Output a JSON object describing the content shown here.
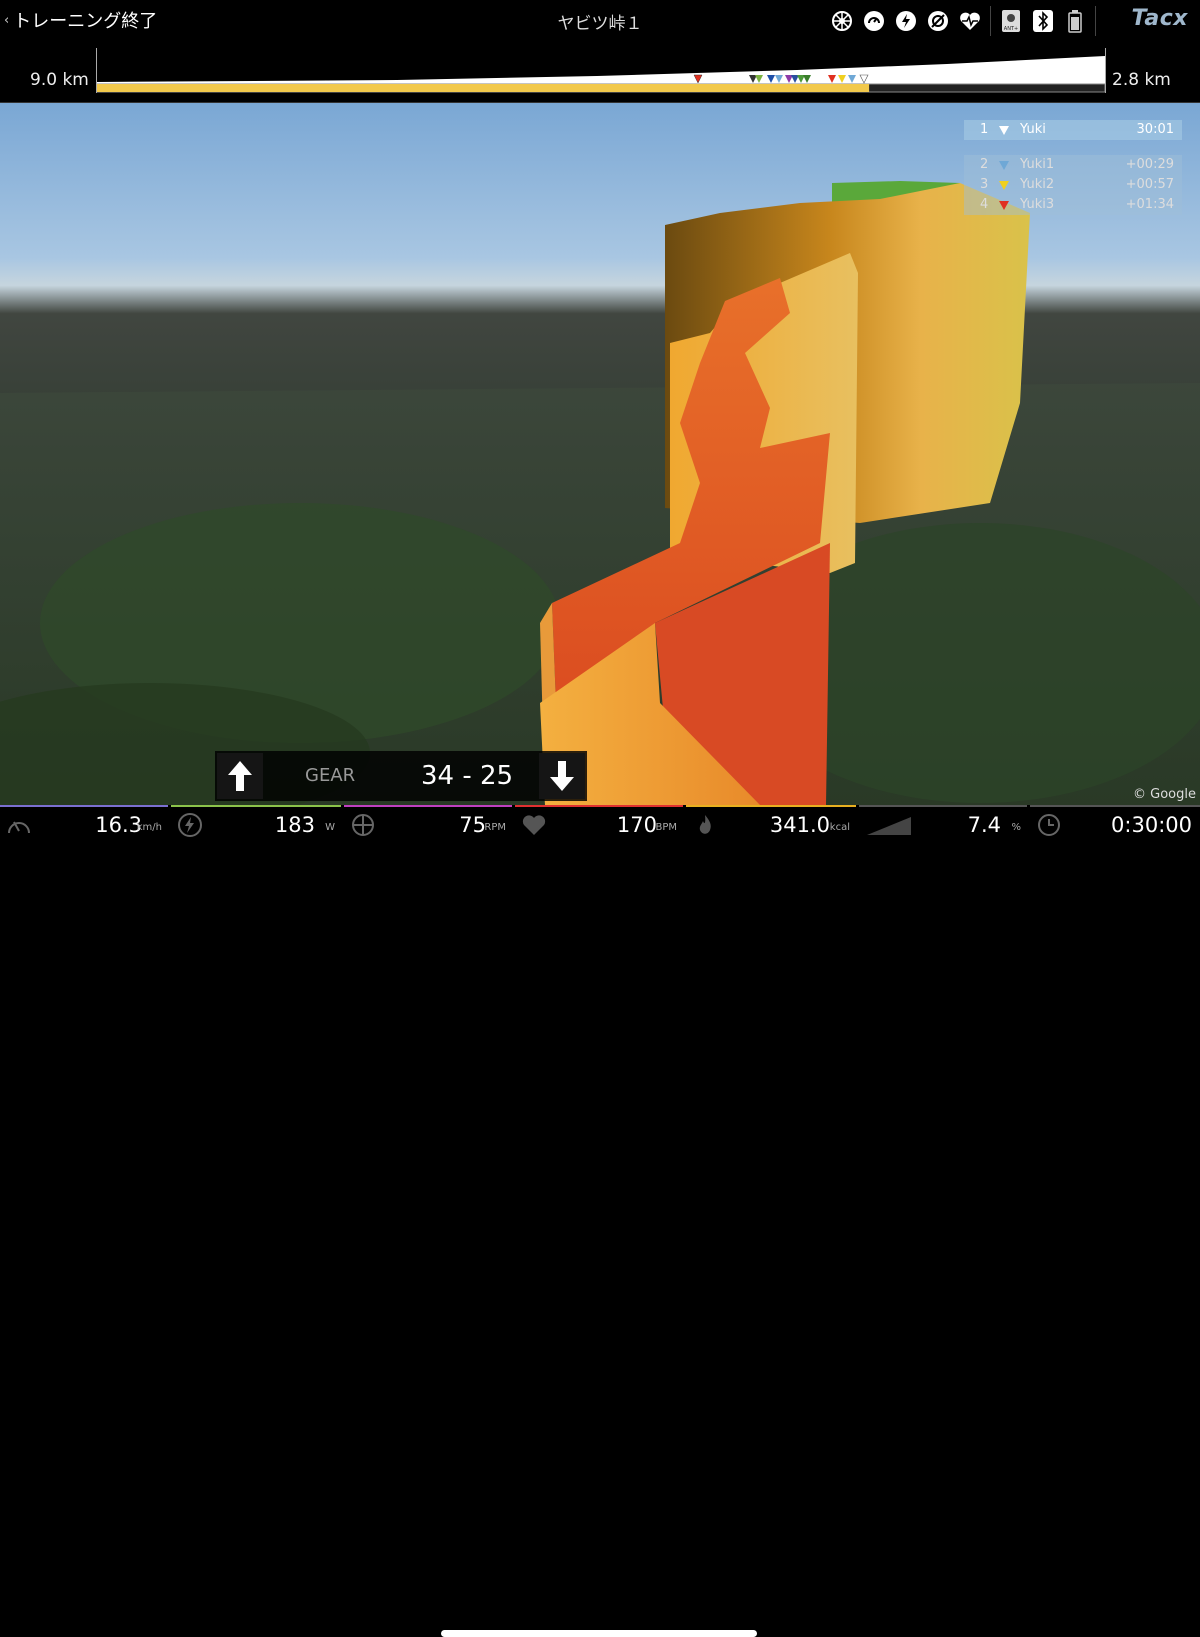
{
  "header": {
    "back_label": "トレーニング終了",
    "title": "ヤビツ峠１",
    "brand": "Tacx",
    "status_icons": [
      "wheel-icon",
      "speed-mode-icon",
      "power-icon",
      "target-icon",
      "heart-rate-icon",
      "ant-icon",
      "bluetooth-icon",
      "battery-icon"
    ]
  },
  "profile": {
    "distance_total": "9.0 km",
    "distance_remaining": "2.8 km",
    "progress": 0.766
  },
  "leaderboard": {
    "leader": {
      "rank": "1",
      "name": "Yuki",
      "time": "30:01",
      "color": "#ffffff"
    },
    "others": [
      {
        "rank": "2",
        "name": "Yuki1",
        "time": "+00:29",
        "color": "#6fa8d6"
      },
      {
        "rank": "3",
        "name": "Yuki2",
        "time": "+00:57",
        "color": "#f0d020"
      },
      {
        "rank": "4",
        "name": "Yuki3",
        "time": "+01:34",
        "color": "#e03020"
      }
    ]
  },
  "gear": {
    "label": "GEAR",
    "value": "34 - 25"
  },
  "copyright": "© Google",
  "metrics": [
    {
      "id": "speed",
      "value": "16.3",
      "unit": "km/h",
      "color": "#7a6fd0"
    },
    {
      "id": "power",
      "value": "183",
      "unit": "W",
      "color": "#8bc34a"
    },
    {
      "id": "cadence",
      "value": "75",
      "unit": "RPM",
      "color": "#c040c0"
    },
    {
      "id": "heart-rate",
      "value": "170",
      "unit": "BPM",
      "color": "#e03030"
    },
    {
      "id": "calories",
      "value": "341.0",
      "unit": "kcal",
      "color": "#e8b020"
    },
    {
      "id": "slope",
      "value": "7.4",
      "unit": "%",
      "color": "#555555"
    },
    {
      "id": "time",
      "value": "0:30:00",
      "unit": "",
      "color": "#555555"
    }
  ],
  "colors": {
    "progress": "#f2c94c",
    "accent_red": "#e2452a",
    "accent_orange": "#f0a030"
  }
}
